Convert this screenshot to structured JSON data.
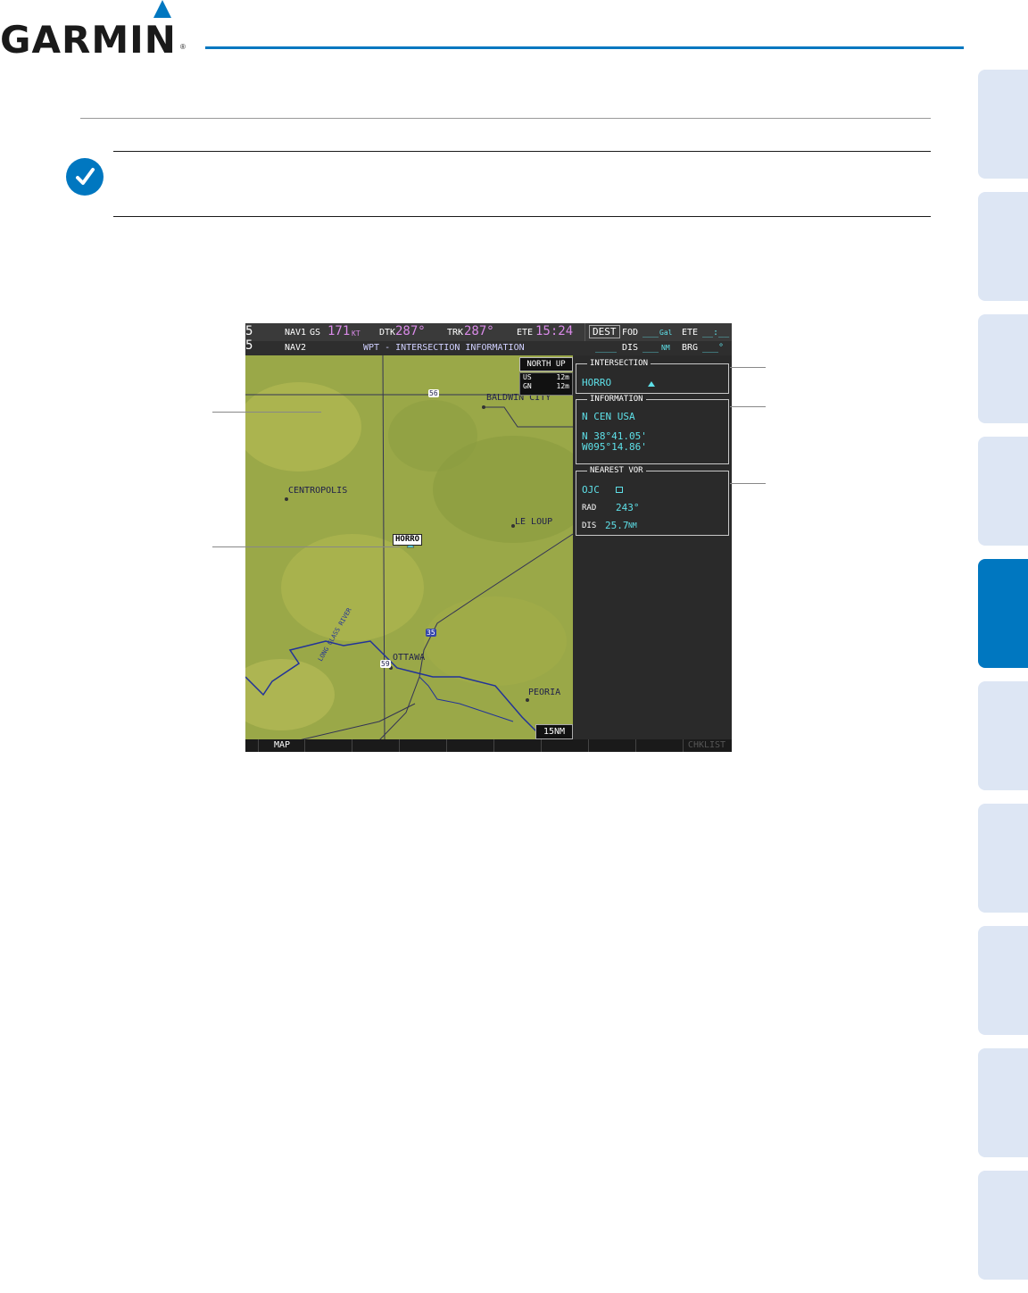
{
  "header": {
    "logo_text": "GARMIN",
    "logo_reg": "®",
    "accent_color": "#0077c0"
  },
  "side_tabs": {
    "count": 10,
    "active_index": 4
  },
  "screen": {
    "top_bar": {
      "left_edge_1": "5",
      "left_edge_2": "5",
      "nav1_label": "NAV1",
      "nav2_label": "NAV2",
      "gs_label": "GS",
      "gs_value": "171",
      "gs_unit": "KT",
      "dtk_label": "DTK",
      "dtk_value": "287°",
      "trk_label": "TRK",
      "trk_value": "287°",
      "ete_label": "ETE",
      "ete_value": "15:24",
      "page_title": "WPT - INTERSECTION INFORMATION",
      "dest_label": "DEST",
      "fod_label": "FOD",
      "fod_value": "___",
      "fod_unit": "Gal",
      "ete2_label": "ETE",
      "ete2_value": "__:__",
      "dest_value": "____",
      "dis_label": "DIS",
      "dis_value": "___",
      "dis_unit": "NM",
      "brg_label": "BRG",
      "brg_value": "___°"
    },
    "map": {
      "orientation": "NORTH UP",
      "us_label": "US",
      "us_value": "12m",
      "gn_label": "GN",
      "gn_value": "12m",
      "range": "15NM",
      "places": {
        "baldwin_city": "BALDWIN CITY",
        "centropolis": "CENTROPOLIS",
        "le_loup": "LE LOUP",
        "horro": "HORRO",
        "ottawa": "OTTAWA",
        "peoria": "PEORIA",
        "river": "LONG GLASS RIVER",
        "hwy_56": "56",
        "hwy_35": "35",
        "hwy_59": "59"
      }
    },
    "intersection_box": {
      "title": "INTERSECTION",
      "ident": "HORRO"
    },
    "information_box": {
      "title": "INFORMATION",
      "region": "N CEN USA",
      "latitude": "N 38°41.05'",
      "longitude": "W095°14.86'"
    },
    "nearest_vor_box": {
      "title": "NEAREST VOR",
      "ident": "OJC",
      "rad_label": "RAD",
      "rad_value": "243°",
      "dis_label": "DIS",
      "dis_value": "25.7",
      "dis_unit": "NM"
    },
    "softkeys": {
      "map": "MAP",
      "chkl": "CHKLIST"
    }
  }
}
